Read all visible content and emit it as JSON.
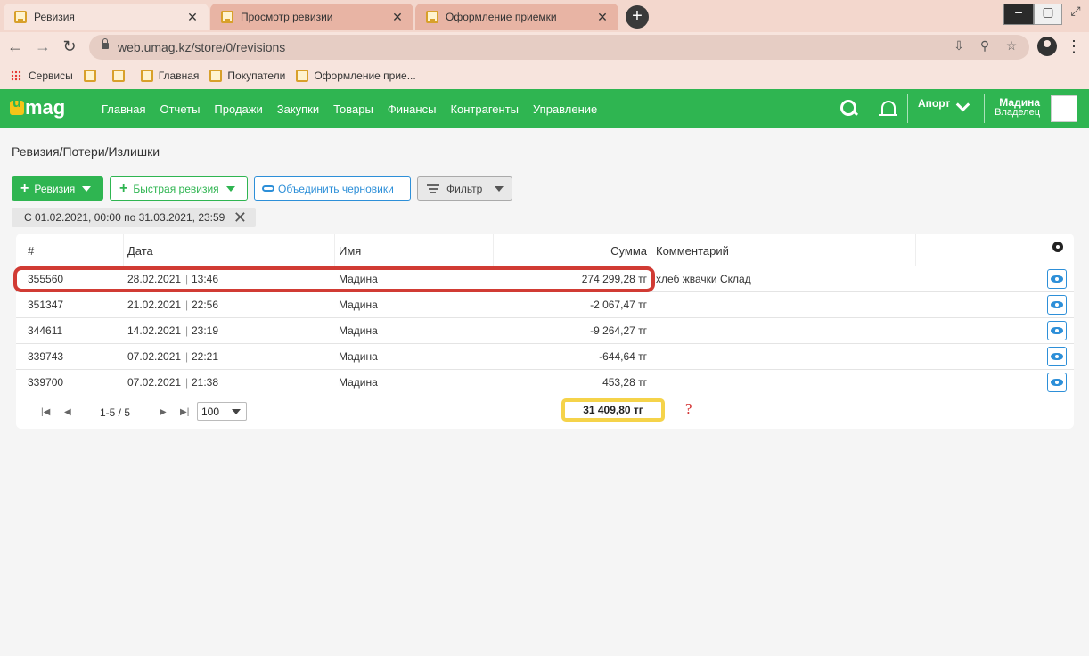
{
  "browser": {
    "tabs": [
      {
        "label": "Ревизия",
        "active": true
      },
      {
        "label": "Просмотр ревизии",
        "active": false
      },
      {
        "label": "Оформление приемки",
        "active": false
      }
    ],
    "close_glyph": "✕",
    "new_tab_glyph": "+",
    "url": "web.umag.kz/store/0/revisions",
    "bookmarks": [
      {
        "label": "Сервисы",
        "icon": "apps-grid-icon"
      },
      {
        "label": "",
        "icon": "umag-favicon"
      },
      {
        "label": "",
        "icon": "umag-favicon"
      },
      {
        "label": "Главная",
        "icon": "umag-favicon"
      },
      {
        "label": "Покупатели",
        "icon": "umag-favicon"
      },
      {
        "label": "Оформление прие...",
        "icon": "umag-favicon"
      }
    ]
  },
  "app": {
    "logo": "mag",
    "menu": [
      "Главная",
      "Отчеты",
      "Продажи",
      "Закупки",
      "Товары",
      "Финансы",
      "Контрагенты",
      "Управление"
    ],
    "store": "Апорт",
    "user_name": "Мадина",
    "user_role": "Владелец",
    "brand_color": "#2fb551"
  },
  "page": {
    "title": "Ревизия/Потери/Излишки",
    "buttons": {
      "revision": "Ревизия",
      "quick_revision": "Быстрая ревизия",
      "merge_drafts": "Объединить черновики",
      "filter": "Фильтр"
    },
    "date_filter": "С 01.02.2021, 00:00 по 31.03.2021, 23:59"
  },
  "table": {
    "columns": {
      "id": "#",
      "date": "Дата",
      "name": "Имя",
      "sum": "Сумма",
      "comment": "Комментарий"
    },
    "rows": [
      {
        "id": "355560",
        "date": "28.02.2021",
        "time": "13:46",
        "name": "Мадина",
        "sum": "274 299,28 тг",
        "comment": "хлеб жвачки Склад"
      },
      {
        "id": "351347",
        "date": "21.02.2021",
        "time": "22:56",
        "name": "Мадина",
        "sum": "-2 067,47 тг",
        "comment": ""
      },
      {
        "id": "344611",
        "date": "14.02.2021",
        "time": "23:19",
        "name": "Мадина",
        "sum": "-9 264,27 тг",
        "comment": ""
      },
      {
        "id": "339743",
        "date": "07.02.2021",
        "time": "22:21",
        "name": "Мадина",
        "sum": "-644,64 тг",
        "comment": ""
      },
      {
        "id": "339700",
        "date": "07.02.2021",
        "time": "21:38",
        "name": "Мадина",
        "sum": "453,28 тг",
        "comment": ""
      }
    ],
    "pagination": "1-5 / 5",
    "page_size": "100",
    "total": "31 409,80 тг",
    "annotation": "?"
  }
}
